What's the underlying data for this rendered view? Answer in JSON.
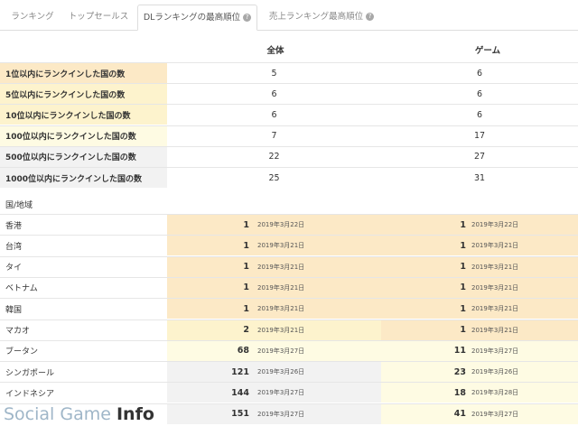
{
  "tabs": [
    {
      "label": "ランキング",
      "active": false,
      "help": false
    },
    {
      "label": "トップセールス",
      "active": false,
      "help": false
    },
    {
      "label": "DLランキングの最高順位",
      "active": true,
      "help": true
    },
    {
      "label": "売上ランキング最高順位",
      "active": false,
      "help": true
    }
  ],
  "help_icon": "?",
  "columns": [
    "全体",
    "ゲーム"
  ],
  "summary_rows": [
    {
      "label": "1位以内にランクインした国の数",
      "overall": "5",
      "game": "6"
    },
    {
      "label": "5位以内にランクインした国の数",
      "overall": "6",
      "game": "6"
    },
    {
      "label": "10位以内にランクインした国の数",
      "overall": "6",
      "game": "6"
    },
    {
      "label": "100位以内にランクインした国の数",
      "overall": "7",
      "game": "17"
    },
    {
      "label": "500位以内にランクインした国の数",
      "overall": "22",
      "game": "27"
    },
    {
      "label": "1000位以内にランクインした国の数",
      "overall": "25",
      "game": "31"
    }
  ],
  "region_header": "国/地域",
  "region_rows": [
    {
      "country": "香港",
      "overall_rank": "1",
      "overall_date": "2019年3月22日",
      "game_rank": "1",
      "game_date": "2019年3月22日"
    },
    {
      "country": "台湾",
      "overall_rank": "1",
      "overall_date": "2019年3月21日",
      "game_rank": "1",
      "game_date": "2019年3月21日"
    },
    {
      "country": "タイ",
      "overall_rank": "1",
      "overall_date": "2019年3月21日",
      "game_rank": "1",
      "game_date": "2019年3月21日"
    },
    {
      "country": "ベトナム",
      "overall_rank": "1",
      "overall_date": "2019年3月21日",
      "game_rank": "1",
      "game_date": "2019年3月21日"
    },
    {
      "country": "韓国",
      "overall_rank": "1",
      "overall_date": "2019年3月21日",
      "game_rank": "1",
      "game_date": "2019年3月21日"
    },
    {
      "country": "マカオ",
      "overall_rank": "2",
      "overall_date": "2019年3月21日",
      "game_rank": "1",
      "game_date": "2019年3月21日"
    },
    {
      "country": "ブータン",
      "overall_rank": "68",
      "overall_date": "2019年3月27日",
      "game_rank": "11",
      "game_date": "2019年3月27日"
    },
    {
      "country": "シンガポール",
      "overall_rank": "121",
      "overall_date": "2019年3月26日",
      "game_rank": "23",
      "game_date": "2019年3月26日"
    },
    {
      "country": "インドネシア",
      "overall_rank": "144",
      "overall_date": "2019年3月27日",
      "game_rank": "18",
      "game_date": "2019年3月28日"
    },
    {
      "country": "",
      "overall_rank": "151",
      "overall_date": "2019年3月27日",
      "game_rank": "41",
      "game_date": "2019年3月27日"
    }
  ],
  "watermark": {
    "part1": "Social Game ",
    "part2": "Info"
  }
}
